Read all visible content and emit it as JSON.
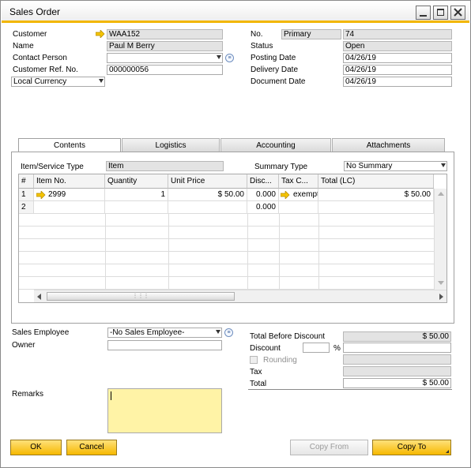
{
  "window": {
    "title": "Sales Order"
  },
  "header_left": {
    "customer_label": "Customer",
    "customer_value": "WAA152",
    "name_label": "Name",
    "name_value": "Paul M  Berry",
    "contact_label": "Contact Person",
    "contact_value": "",
    "ref_label": "Customer Ref. No.",
    "ref_value": "000000056",
    "currency_value": "Local Currency"
  },
  "header_right": {
    "no_label": "No.",
    "series_value": "Primary",
    "no_value": "74",
    "status_label": "Status",
    "status_value": "Open",
    "posting_label": "Posting Date",
    "posting_value": "04/26/19",
    "delivery_label": "Delivery Date",
    "delivery_value": "04/26/19",
    "document_label": "Document Date",
    "document_value": "04/26/19"
  },
  "tabs": [
    {
      "label": "Contents",
      "active": true
    },
    {
      "label": "Logistics",
      "active": false
    },
    {
      "label": "Accounting",
      "active": false
    },
    {
      "label": "Attachments",
      "active": false
    }
  ],
  "contents": {
    "item_type_label": "Item/Service Type",
    "item_type_value": "Item",
    "summary_label": "Summary Type",
    "summary_value": "No Summary"
  },
  "grid": {
    "columns": [
      "#",
      "Item No.",
      "Quantity",
      "Unit Price",
      "Disc...",
      "Tax C...",
      "Total (LC)"
    ],
    "rows": [
      {
        "num": "1",
        "item_no": "2999",
        "quantity": "1",
        "unit_price": "$ 50.00",
        "discount": "0.000",
        "tax_code": "exempt",
        "total": "$ 50.00"
      },
      {
        "num": "2",
        "item_no": "",
        "quantity": "",
        "unit_price": "",
        "discount": "0.000",
        "tax_code": "",
        "total": ""
      }
    ]
  },
  "footer_left": {
    "sales_employee_label": "Sales Employee",
    "sales_employee_value": "-No Sales Employee-",
    "owner_label": "Owner",
    "owner_value": "",
    "remarks_label": "Remarks",
    "remarks_value": ""
  },
  "totals": {
    "before_discount_label": "Total Before Discount",
    "before_discount_value": "$ 50.00",
    "discount_label": "Discount",
    "discount_pct": "",
    "pct_symbol": "%",
    "discount_value": "",
    "rounding_label": "Rounding",
    "rounding_value": "",
    "tax_label": "Tax",
    "tax_value": "",
    "total_label": "Total",
    "total_value": "$ 50.00"
  },
  "buttons": {
    "ok": "OK",
    "cancel": "Cancel",
    "copy_from": "Copy From",
    "copy_to": "Copy To"
  },
  "colors": {
    "accent": "#f2b600",
    "readonly_bg": "#e3e3e3",
    "remarks_bg": "#fff3a6"
  },
  "icons": [
    "link-arrow-icon",
    "choose-from-list-icon",
    "dropdown-arrow-icon",
    "minimize-icon",
    "maximize-icon",
    "close-icon",
    "expand-grid-icon"
  ]
}
